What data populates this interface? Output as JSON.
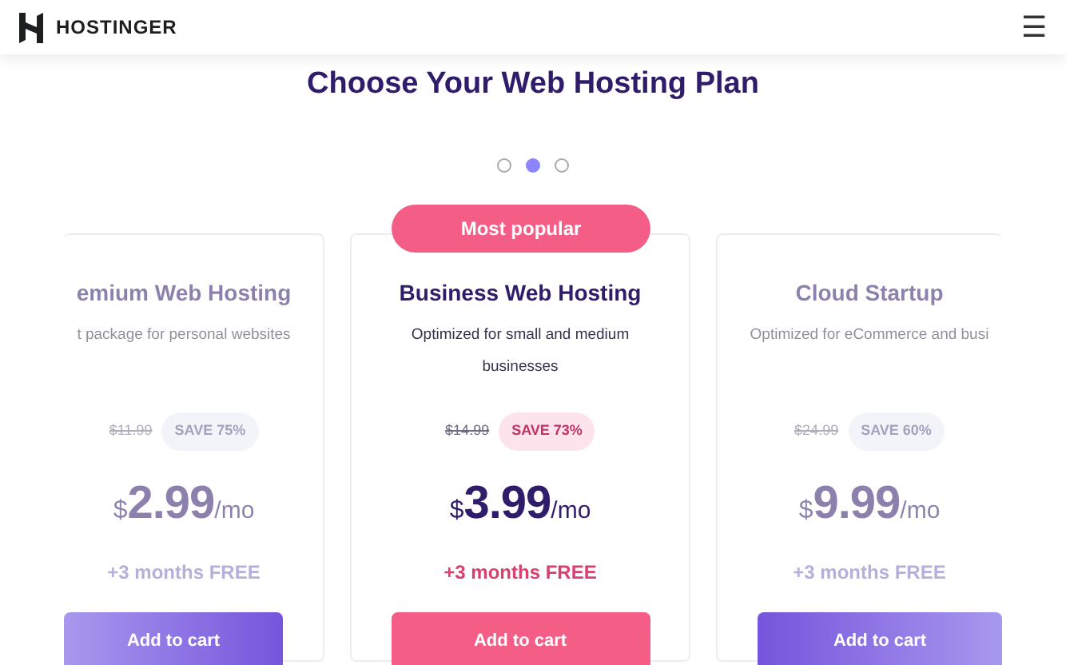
{
  "header": {
    "brand": "HOSTINGER",
    "menu_icon": "☰"
  },
  "title": "Choose Your Web Hosting Plan",
  "carousel_dots": [
    {
      "selected": false
    },
    {
      "selected": true
    },
    {
      "selected": false
    }
  ],
  "plans": [
    {
      "selected": false,
      "name": "emium Web Hosting",
      "description": "t package for personal websites",
      "old_price": "$11.99",
      "save": "SAVE 75%",
      "currency": "$",
      "price": "2.99",
      "period": "/mo",
      "bonus": "+3 months FREE",
      "button": "Add to cart"
    },
    {
      "selected": true,
      "badge": "Most popular",
      "name": "Business Web Hosting",
      "description": "Optimized for small and medium businesses",
      "old_price": "$14.99",
      "save": "SAVE 73%",
      "currency": "$",
      "price": "3.99",
      "period": "/mo",
      "bonus": "+3 months FREE",
      "button": "Add to cart"
    },
    {
      "selected": false,
      "name": "Cloud Startup",
      "description": "Optimized for eCommerce and busi",
      "old_price": "$24.99",
      "save": "SAVE 60%",
      "currency": "$",
      "price": "9.99",
      "period": "/mo",
      "bonus": "+3 months FREE",
      "button": "Add to cart"
    }
  ]
}
